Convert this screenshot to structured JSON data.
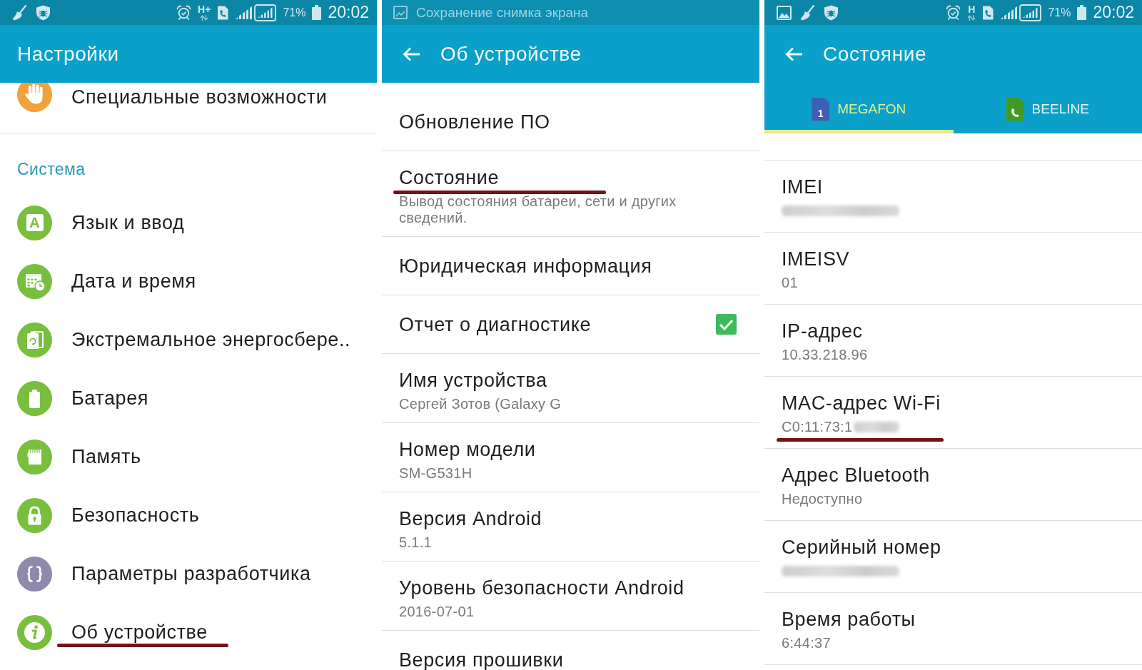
{
  "settings_screen": {
    "status_bar": {
      "network": "H+",
      "battery": "71%",
      "time": "20:02"
    },
    "title": "Настройки",
    "items": [
      {
        "label": "Специальные возможности",
        "underlined": false
      }
    ],
    "section": {
      "header": "Система",
      "items": [
        {
          "label": "Язык и ввод",
          "icon_glyph": "A",
          "underlined": false
        },
        {
          "label": "Дата и время",
          "underlined": false
        },
        {
          "label": "Экстремальное энергосбере..",
          "underlined": false
        },
        {
          "label": "Батарея",
          "underlined": false
        },
        {
          "label": "Память",
          "underlined": false
        },
        {
          "label": "Безопасность",
          "underlined": false
        },
        {
          "label": "Параметры разработчика",
          "underlined": false
        },
        {
          "label": "Об устройстве",
          "underlined": true
        }
      ]
    }
  },
  "about_screen": {
    "status_bar": {
      "notification": "Сохранение снимка экрана"
    },
    "title": "Об устройстве",
    "items": [
      {
        "kind": "link",
        "title": "Обновление ПО",
        "underlined": false
      },
      {
        "kind": "link",
        "title": "Состояние",
        "summary": "Вывод состояния батареи, сети и других сведений.",
        "underlined": true
      },
      {
        "kind": "link",
        "title": "Юридическая информация",
        "underlined": false
      },
      {
        "kind": "checkbox",
        "title": "Отчет о диагностике",
        "checked": true,
        "underlined": false
      },
      {
        "kind": "link",
        "title": "Имя устройства",
        "summary": "Сергей Зотов (Galaxy G",
        "underlined": false
      },
      {
        "kind": "link",
        "title": "Номер модели",
        "summary": "SM-G531H",
        "underlined": false
      },
      {
        "kind": "link",
        "title": "Версия Android",
        "summary": "5.1.1",
        "underlined": false
      },
      {
        "kind": "link",
        "title": "Уровень безопасности Android",
        "summary": "2016-07-01",
        "underlined": false
      },
      {
        "kind": "link",
        "title": "Версия прошивки",
        "underlined": false
      }
    ]
  },
  "status_screen": {
    "status_bar": {
      "network": "H",
      "battery": "71%",
      "time": "20:02"
    },
    "title": "Состояние",
    "tabs": [
      {
        "label": "MEGAFON",
        "sim_number": "1",
        "color": "#3d5fb4",
        "selected": true
      },
      {
        "label": "BEELINE",
        "color": "#3f9b23",
        "selected": false
      }
    ],
    "items": [
      {
        "label": "IMEI",
        "redacted": true,
        "underlined": false
      },
      {
        "label": "IMEISV",
        "value": "01",
        "redacted": false,
        "underlined": false
      },
      {
        "label": "IP-адрес",
        "value": "10.33.218.96",
        "redacted": false,
        "underlined": false
      },
      {
        "label": "MAC-адрес Wi-Fi",
        "value": "C0:11:73:1",
        "redacted": true,
        "underlined": true
      },
      {
        "label": "Адрес Bluetooth",
        "value": "Недоступно",
        "redacted": false,
        "underlined": false
      },
      {
        "label": "Серийный номер",
        "redacted": true,
        "underlined": false
      },
      {
        "label": "Время работы",
        "value": "6:44:37",
        "redacted": false,
        "underlined": false
      }
    ]
  }
}
